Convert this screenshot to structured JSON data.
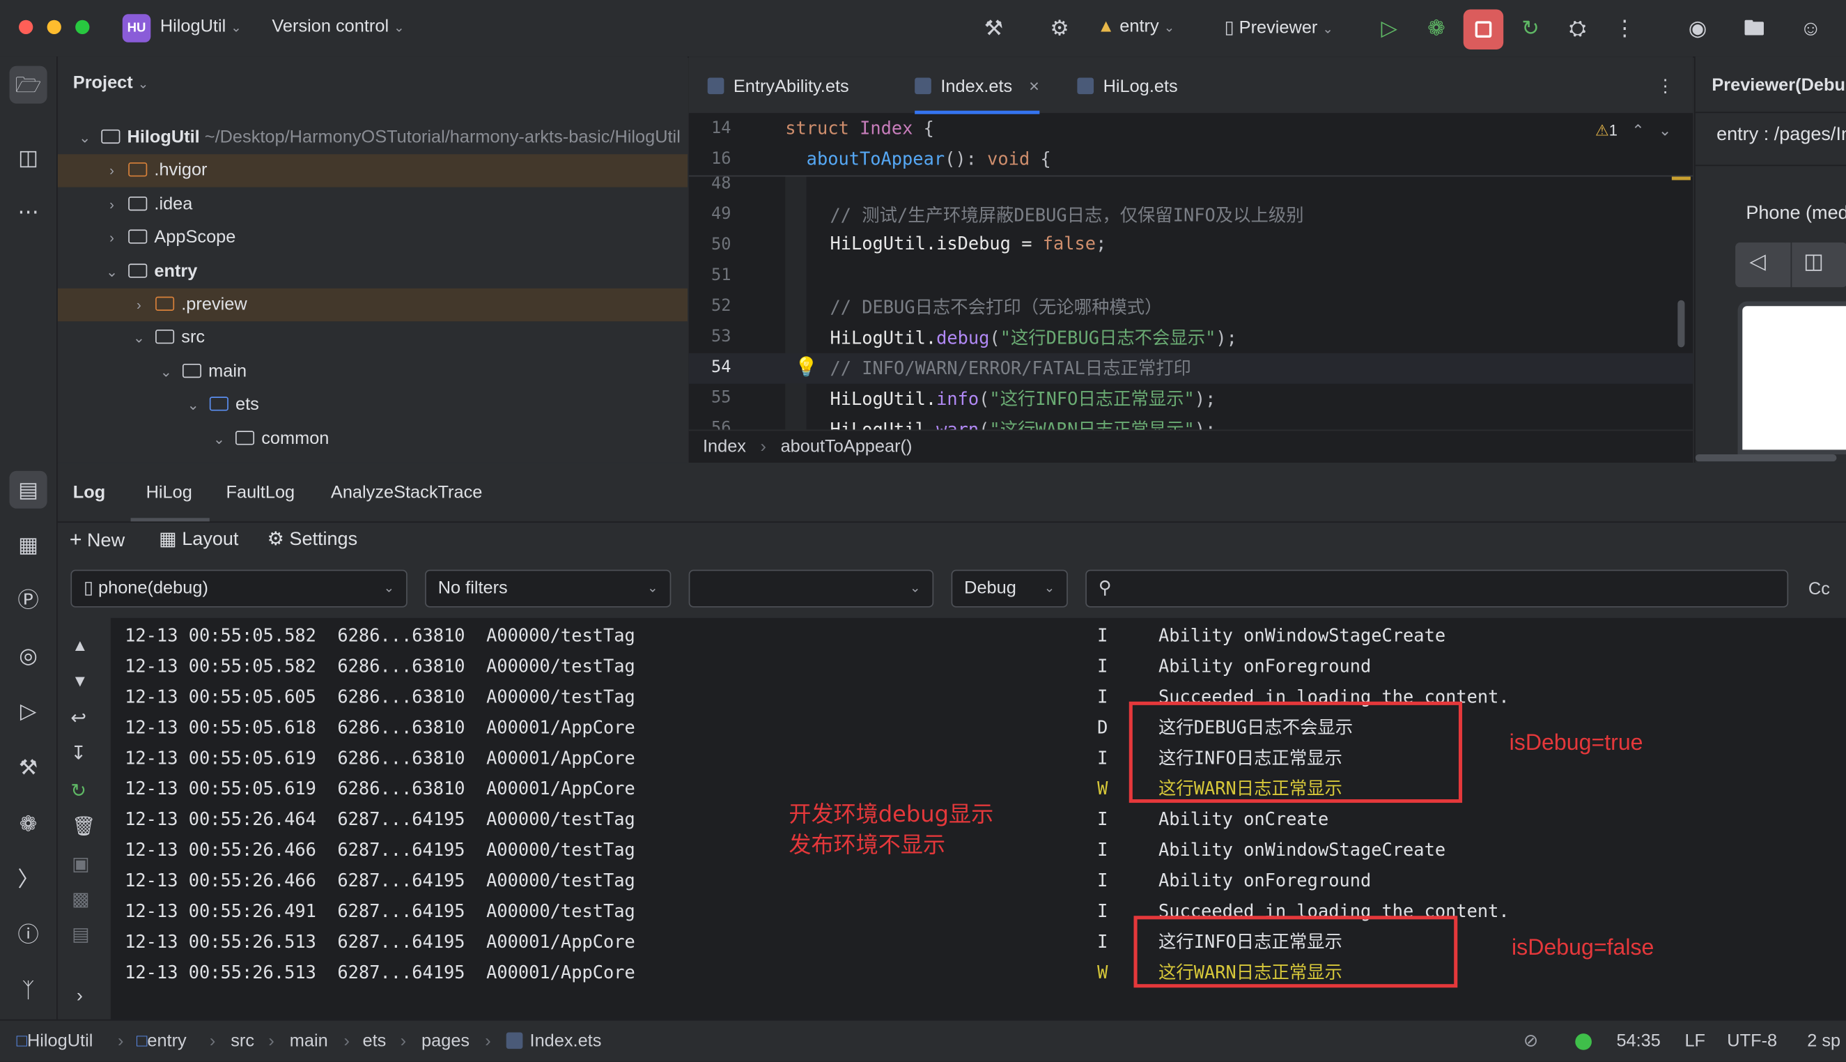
{
  "titlebar": {
    "project_badge": "HU",
    "project_name": "HilogUtil",
    "vcs": "Version control",
    "run_config": "entry",
    "device": "Previewer"
  },
  "colors": {
    "accent": "#3574f0",
    "stop_button": "#db5c5c",
    "run": "#5fb865",
    "annotation": "#e5383b",
    "warn": "#d7c83a"
  },
  "project": {
    "header": "Project",
    "root_name": "HilogUtil",
    "root_path": "~/Desktop/HarmonyOSTutorial/harmony-arkts-basic/HilogUtil",
    "items": [
      ".hvigor",
      ".idea",
      "AppScope",
      "entry",
      ".preview",
      "src",
      "main",
      "ets",
      "common"
    ]
  },
  "editor": {
    "tabs": [
      "EntryAbility.ets",
      "Index.ets",
      "HiLog.ets"
    ],
    "warnings": "1",
    "sticky": {
      "lines": [
        "14",
        "16"
      ],
      "struct_kw": "struct",
      "struct_name": "Index",
      "struct_brace": " {",
      "fn": "aboutToAppear",
      "fn_sig": "(): ",
      "fn_void": "void",
      "fn_brace": " {"
    },
    "line_numbers": [
      "48",
      "49",
      "50",
      "51",
      "52",
      "53",
      "54",
      "55",
      "56"
    ],
    "code": {
      "c49": "// 测试/生产环境屏蔽DEBUG日志，仅保留INFO及以上级别",
      "l50a": "HiLogUtil.isDebug = ",
      "l50b": "false",
      "l50c": ";",
      "c52": "// DEBUG日志不会打印（无论哪种模式）",
      "l53a": "HiLogUtil.",
      "l53b": "debug",
      "l53c": "(",
      "l53d": "\"这行DEBUG日志不会显示\"",
      "l53e": ");",
      "c54": "// INFO/WARN/ERROR/FATAL日志正常打印",
      "l55a": "HiLogUtil.",
      "l55b": "info",
      "l55c": "(",
      "l55d": "\"这行INFO日志正常显示\"",
      "l55e": ");",
      "l56a": "HiLogUtil.",
      "l56b": "warn",
      "l56c": "(",
      "l56d": "\"这行WARN日志正常显示\"",
      "l56e": ");"
    },
    "breadcrumb": [
      "Index",
      "aboutToAppear()"
    ]
  },
  "previewer": {
    "title": "Previewer(Debug)",
    "page": "entry : /pages/Index",
    "device": "Phone (medium)"
  },
  "log": {
    "tabs": [
      "Log",
      "HiLog",
      "FaultLog",
      "AnalyzeStackTrace"
    ],
    "toolbar": {
      "new": "New",
      "layout": "Layout",
      "settings": "Settings"
    },
    "device_select": "phone(debug)",
    "filter_select": "No filters",
    "process_select": "",
    "level_select": "Debug",
    "search_placeholder": "",
    "case_btn": "Cc",
    "rows": [
      {
        "time": "12-13 00:55:05.582",
        "pid": "6286...63810",
        "tag": "A00000/testTag",
        "level": "I",
        "msg": "Ability onWindowStageCreate"
      },
      {
        "time": "12-13 00:55:05.582",
        "pid": "6286...63810",
        "tag": "A00000/testTag",
        "level": "I",
        "msg": "Ability onForeground"
      },
      {
        "time": "12-13 00:55:05.605",
        "pid": "6286...63810",
        "tag": "A00000/testTag",
        "level": "I",
        "msg": "Succeeded in loading the content."
      },
      {
        "time": "12-13 00:55:05.618",
        "pid": "6286...63810",
        "tag": "A00001/AppCore",
        "level": "D",
        "msg": "这行DEBUG日志不会显示"
      },
      {
        "time": "12-13 00:55:05.619",
        "pid": "6286...63810",
        "tag": "A00001/AppCore",
        "level": "I",
        "msg": "这行INFO日志正常显示"
      },
      {
        "time": "12-13 00:55:05.619",
        "pid": "6286...63810",
        "tag": "A00001/AppCore",
        "level": "W",
        "msg": "这行WARN日志正常显示"
      },
      {
        "time": "12-13 00:55:26.464",
        "pid": "6287...64195",
        "tag": "A00000/testTag",
        "level": "I",
        "msg": "Ability onCreate"
      },
      {
        "time": "12-13 00:55:26.466",
        "pid": "6287...64195",
        "tag": "A00000/testTag",
        "level": "I",
        "msg": "Ability onWindowStageCreate"
      },
      {
        "time": "12-13 00:55:26.466",
        "pid": "6287...64195",
        "tag": "A00000/testTag",
        "level": "I",
        "msg": "Ability onForeground"
      },
      {
        "time": "12-13 00:55:26.491",
        "pid": "6287...64195",
        "tag": "A00000/testTag",
        "level": "I",
        "msg": "Succeeded in loading the content."
      },
      {
        "time": "12-13 00:55:26.513",
        "pid": "6287...64195",
        "tag": "A00001/AppCore",
        "level": "I",
        "msg": "这行INFO日志正常显示"
      },
      {
        "time": "12-13 00:55:26.513",
        "pid": "6287...64195",
        "tag": "A00001/AppCore",
        "level": "W",
        "msg": "这行WARN日志正常显示"
      }
    ],
    "annotations": {
      "debug_true": "isDebug=true",
      "debug_false": "isDebug=false",
      "note_line1": "开发环境debug显示",
      "note_line2": "发布环境不显示"
    }
  },
  "statusbar": {
    "path": [
      "HilogUtil",
      "entry",
      "src",
      "main",
      "ets",
      "pages",
      "Index.ets"
    ],
    "cursor": "54:35",
    "line_sep": "LF",
    "encoding": "UTF-8",
    "indent": "2 sp"
  }
}
